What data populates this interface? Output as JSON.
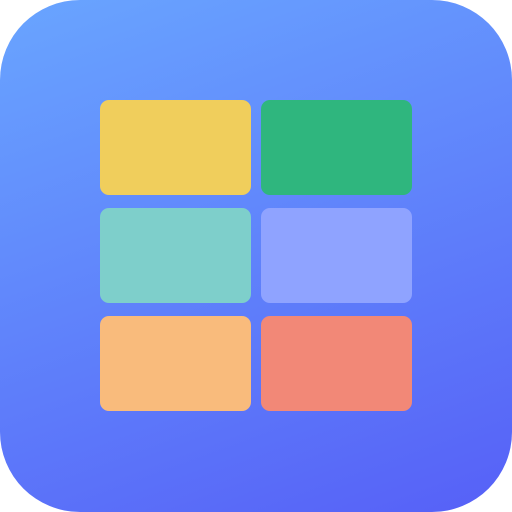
{
  "icon": {
    "name": "grid-app-icon",
    "background": {
      "gradient_start": "#69A5FF",
      "gradient_end": "#5660F7"
    },
    "tiles": [
      {
        "name": "tile-yellow",
        "color": "#F0CE5C"
      },
      {
        "name": "tile-green",
        "color": "#2FB67E"
      },
      {
        "name": "tile-teal",
        "color": "#7ECFCB"
      },
      {
        "name": "tile-periwinkle",
        "color": "#8FA3FF"
      },
      {
        "name": "tile-orange",
        "color": "#F9BB7C"
      },
      {
        "name": "tile-coral",
        "color": "#F28877"
      }
    ]
  }
}
